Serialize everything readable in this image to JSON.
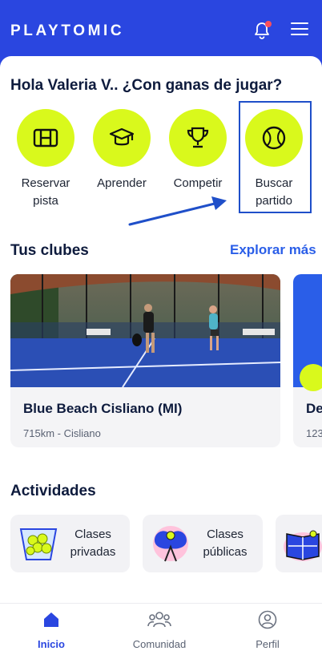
{
  "header": {
    "logo": "PLAYTOMIC",
    "bell_icon": "bell-icon",
    "menu_icon": "hamburger-menu-icon"
  },
  "greeting": "Hola Valeria V.. ¿Con ganas de jugar?",
  "actions": [
    {
      "label": "Reservar\npista",
      "icon": "court-icon"
    },
    {
      "label": "Aprender",
      "icon": "graduation-cap-icon"
    },
    {
      "label": "Competir",
      "icon": "trophy-icon"
    },
    {
      "label": "Buscar\npartido",
      "icon": "ball-icon"
    }
  ],
  "clubs": {
    "title": "Tus clubes",
    "explore_label": "Explorar más",
    "items": [
      {
        "name": "Blue Beach Cisliano (MI)",
        "subtitle": "715km - Cisliano"
      },
      {
        "name": "De",
        "subtitle": "123"
      }
    ]
  },
  "activities": {
    "title": "Actividades",
    "items": [
      {
        "label": "Clases\nprivadas",
        "icon": "balls-basket-icon"
      },
      {
        "label": "Clases\npúblicas",
        "icon": "players-group-icon"
      },
      {
        "label": "",
        "icon": "court-book-icon"
      }
    ]
  },
  "nav": [
    {
      "label": "Inicio",
      "icon": "home-icon",
      "active": true
    },
    {
      "label": "Comunidad",
      "icon": "community-icon",
      "active": false
    },
    {
      "label": "Perfil",
      "icon": "profile-icon",
      "active": false
    }
  ],
  "colors": {
    "brand_blue": "#2a46e0",
    "accent_lime": "#d9f91c",
    "link_blue": "#2a5ee8"
  }
}
